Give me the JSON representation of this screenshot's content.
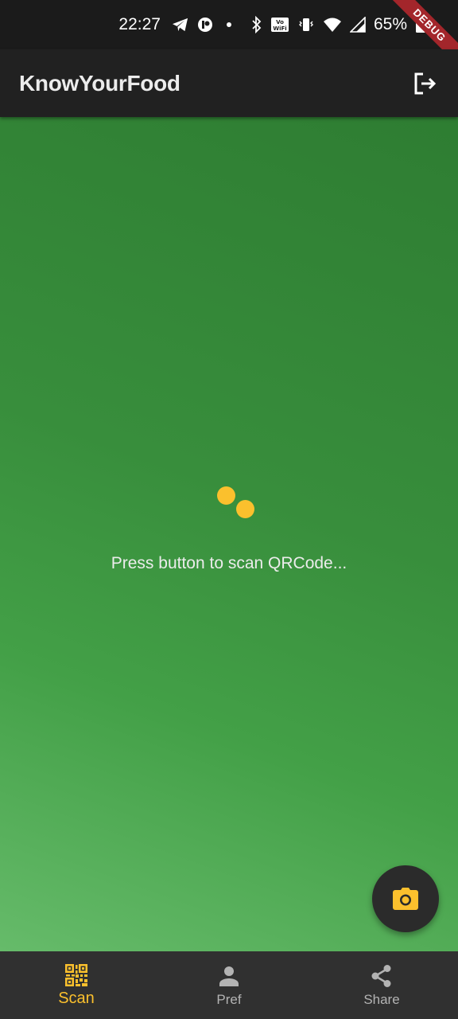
{
  "status_bar": {
    "time": "22:27",
    "battery": "65%",
    "icons": [
      "telegram-icon",
      "app-notification-icon",
      "dot-icon",
      "bluetooth-icon",
      "vowifi-icon",
      "vibrate-icon",
      "wifi-icon",
      "signal-icon",
      "battery-icon"
    ]
  },
  "debug_banner": "DEBUG",
  "app_bar": {
    "title": "KnowYourFood",
    "action_icon": "logout-icon"
  },
  "main": {
    "message": "Press button to scan QRCode...",
    "loader_color": "#fbc02d",
    "background": {
      "top": "#2e7d32",
      "bottom": "#66bb6a"
    }
  },
  "fab": {
    "icon": "camera-icon",
    "icon_color": "#fbc02d"
  },
  "bottom_nav": {
    "items": [
      {
        "label": "Scan",
        "icon": "qr-code-icon",
        "active": true
      },
      {
        "label": "Pref",
        "icon": "person-icon",
        "active": false
      },
      {
        "label": "Share",
        "icon": "share-icon",
        "active": false
      }
    ],
    "active_color": "#fbc02d",
    "inactive_color": "#b3b3b3"
  }
}
